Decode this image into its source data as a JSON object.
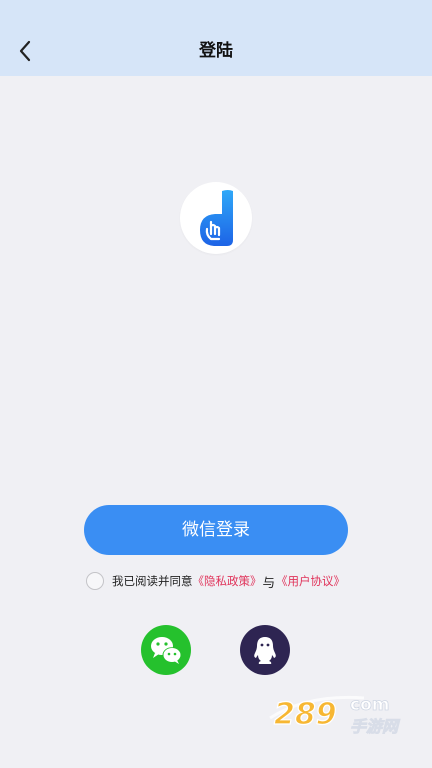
{
  "header": {
    "title": "登陆"
  },
  "login": {
    "wechat_button_label": "微信登录"
  },
  "agreement": {
    "prefix": "我已阅读并同意",
    "privacy_link": "《隐私政策》",
    "and_text": "与",
    "user_link": "《用户协议》",
    "checked": false
  },
  "social_logins": [
    {
      "icon": "wechat-icon",
      "color": "#25c12d"
    },
    {
      "icon": "qq-penguin-icon",
      "color": "#2e2552"
    }
  ],
  "watermark": {
    "number": "289",
    "suffix": "com",
    "subtext": "手游网"
  },
  "colors": {
    "header_bg": "#d6e5f8",
    "page_bg": "#f0f0f4",
    "primary": "#3a8ef3",
    "link": "#e0335a"
  }
}
